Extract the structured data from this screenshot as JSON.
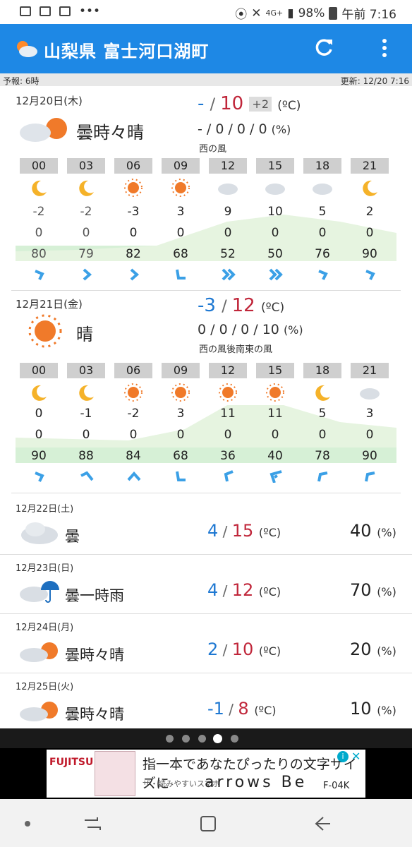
{
  "status": {
    "battery": "98%",
    "time": "午前 7:16",
    "network": "4G+"
  },
  "app": {
    "title": "山梨県 富士河口湖町",
    "forecast_label": "予報: 6時",
    "updated_label": "更新: 12/20 7:16"
  },
  "days": [
    {
      "date": "12月20日(木)",
      "weather": "曇時々晴",
      "icon": "cloud-sun-icon",
      "low": "-",
      "high": "10",
      "diff": "+2",
      "unit": "(ºC)",
      "rain": "- / 0 / 0 / 0",
      "rain_unit": "(%)",
      "wind": "西の風",
      "hours": [
        "00",
        "03",
        "06",
        "09",
        "12",
        "15",
        "18",
        "21"
      ],
      "hour_icons": [
        "moon-icon",
        "moon-icon",
        "sun-icon",
        "sun-icon",
        "cloud-icon",
        "cloud-icon",
        "cloud-icon",
        "moon-icon"
      ],
      "temps": [
        "-2",
        "-2",
        "-3",
        "3",
        "9",
        "10",
        "5",
        "2"
      ],
      "precip": [
        "0",
        "0",
        "0",
        "0",
        "0",
        "0",
        "0",
        "0"
      ],
      "humidity": [
        "80",
        "79",
        "82",
        "68",
        "52",
        "50",
        "76",
        "90"
      ]
    },
    {
      "date": "12月21日(金)",
      "weather": "晴",
      "icon": "sun-icon",
      "low": "-3",
      "high": "12",
      "unit": "(ºC)",
      "rain": "0 / 0 / 0 / 10",
      "rain_unit": "(%)",
      "wind": "西の風後南東の風",
      "hours": [
        "00",
        "03",
        "06",
        "09",
        "12",
        "15",
        "18",
        "21"
      ],
      "hour_icons": [
        "moon-icon",
        "moon-icon",
        "sun-icon",
        "sun-icon",
        "sun-icon",
        "sun-icon",
        "moon-icon",
        "cloud-icon"
      ],
      "temps": [
        "0",
        "-1",
        "-2",
        "3",
        "11",
        "11",
        "5",
        "3"
      ],
      "precip": [
        "0",
        "0",
        "0",
        "0",
        "0",
        "0",
        "0",
        "0"
      ],
      "humidity": [
        "90",
        "88",
        "84",
        "68",
        "36",
        "40",
        "78",
        "90"
      ]
    }
  ],
  "weekly": [
    {
      "date": "12月22日(土)",
      "weather": "曇",
      "icon": "cloud-icon",
      "low": "4",
      "high": "15",
      "unit": "(ºC)",
      "pop": "40",
      "pop_unit": "(%)"
    },
    {
      "date": "12月23日(日)",
      "weather": "曇一時雨",
      "icon": "cloud-umbrella-icon",
      "low": "4",
      "high": "12",
      "unit": "(ºC)",
      "pop": "70",
      "pop_unit": "(%)"
    },
    {
      "date": "12月24日(月)",
      "weather": "曇時々晴",
      "icon": "cloud-sun-icon",
      "low": "2",
      "high": "10",
      "unit": "(ºC)",
      "pop": "20",
      "pop_unit": "(%)"
    },
    {
      "date": "12月25日(火)",
      "weather": "曇時々晴",
      "icon": "cloud-sun-icon",
      "low": "-1",
      "high": "8",
      "unit": "(ºC)",
      "pop": "10",
      "pop_unit": "(%)"
    }
  ],
  "pager": {
    "count": 5,
    "active_index": 3
  },
  "ad": {
    "brand": "FUJITSU",
    "headline": "指一本であなたぴったりの文字サイズに",
    "sub": "ザ・読みやすいスマホ",
    "model": "arrows Be",
    "code": "F-04K"
  },
  "colors": {
    "appbar": "#1e88e5",
    "low_temp": "#1e78d2",
    "high_temp": "#c0263a",
    "humidity_band": "#d6f0d6",
    "wind_arrow": "#3ba0e6"
  }
}
